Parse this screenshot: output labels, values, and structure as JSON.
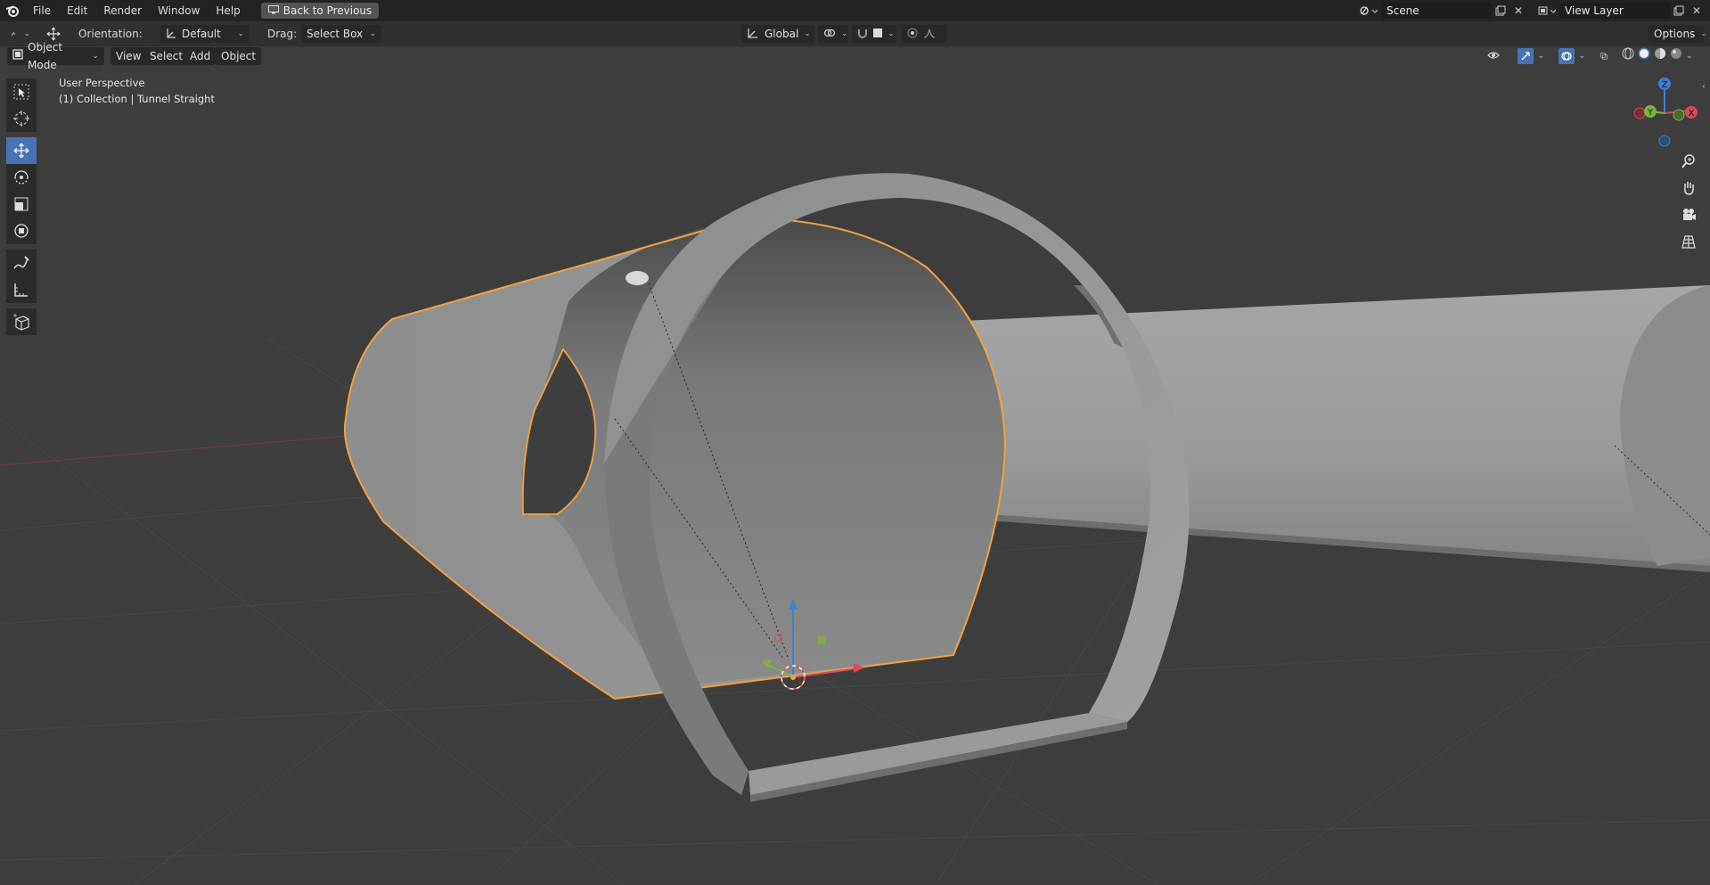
{
  "menu": {
    "items": [
      "File",
      "Edit",
      "Render",
      "Window",
      "Help"
    ],
    "back_label": "Back to Previous"
  },
  "scene": {
    "name": "Scene"
  },
  "view_layer": {
    "name": "View Layer"
  },
  "toolheader": {
    "orientation_label": "Orientation:",
    "orientation_value": "Default",
    "drag_label": "Drag:",
    "drag_value": "Select Box",
    "transform_value": "Global",
    "options_label": "Options"
  },
  "viewport_header": {
    "mode": "Object Mode",
    "menus": [
      "View",
      "Select",
      "Add",
      "Object"
    ]
  },
  "viewport": {
    "perspective": "User Perspective",
    "collection": "(1) Collection | Tunnel Straight"
  },
  "gizmo": {
    "z": "Z",
    "y": "Y",
    "x": "X"
  },
  "colors": {
    "selection": "#f5a043",
    "axis_x": "#d94a5a",
    "axis_y": "#7fb33d",
    "axis_z": "#3d7fd9",
    "active_tool": "#4772b3"
  },
  "toolbar": {
    "tools": [
      "select-box",
      "cursor",
      "move",
      "rotate",
      "scale",
      "transform",
      "annotate",
      "measure",
      "add-cube"
    ],
    "active": "move"
  }
}
